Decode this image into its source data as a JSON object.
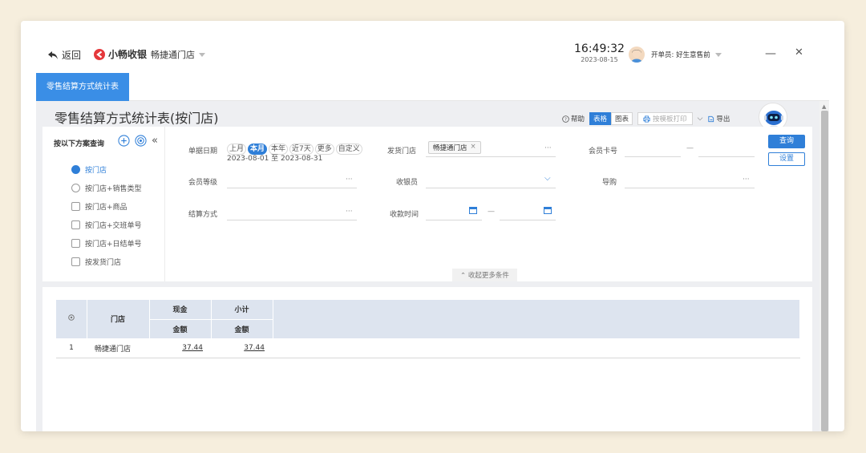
{
  "topbar": {
    "back_label": "返回",
    "brand": "小畅收银",
    "store": "畅捷通门店",
    "time": "16:49:32",
    "date": "2023-08-15",
    "operator": "开单员: 好生意售前"
  },
  "tabs": [
    {
      "label": "零售结算方式统计表"
    }
  ],
  "page": {
    "title": "零售结算方式统计表(按门店)",
    "toolbar": {
      "help": "帮助",
      "table": "表格",
      "chart": "图表",
      "print": "按模板打印",
      "export": "导出"
    }
  },
  "scheme": {
    "title": "按以下方案查询",
    "items": [
      {
        "label": "按门店",
        "icon": "store-icon",
        "active": true
      },
      {
        "label": "按门店+销售类型",
        "icon": "clock-icon"
      },
      {
        "label": "按门店+商品",
        "icon": "goods-icon"
      },
      {
        "label": "按门店+交班单号",
        "icon": "shift-icon"
      },
      {
        "label": "按门店+日结单号",
        "icon": "daily-icon"
      },
      {
        "label": "按发货门店",
        "icon": "chart-icon"
      }
    ]
  },
  "filters": {
    "doc_date_label": "单据日期",
    "date_options": [
      "上月",
      "本月",
      "本年",
      "近7天",
      "更多",
      "自定义"
    ],
    "date_active": "本月",
    "date_range": "2023-08-01 至 2023-08-31",
    "ship_store_label": "发货门店",
    "ship_store_value": "畅捷通门店",
    "member_card_label": "会员卡号",
    "member_level_label": "会员等级",
    "cashier_label": "收银员",
    "guide_label": "导购",
    "settle_method_label": "结算方式",
    "receive_time_label": "收款时间",
    "ellipsis": "···",
    "dash": "—",
    "collapse": "收起更多条件",
    "query": "查询",
    "settings": "设置"
  },
  "table": {
    "headers": {
      "store": "门店",
      "cash": "现金",
      "subtotal": "小计",
      "amount": "金额"
    },
    "rows": [
      {
        "index": "1",
        "store": "畅捷通门店",
        "cash": "37.44",
        "subtotal": "37.44"
      }
    ]
  },
  "colors": {
    "accent": "#2f7fd8",
    "tab": "#3a8ee6"
  }
}
